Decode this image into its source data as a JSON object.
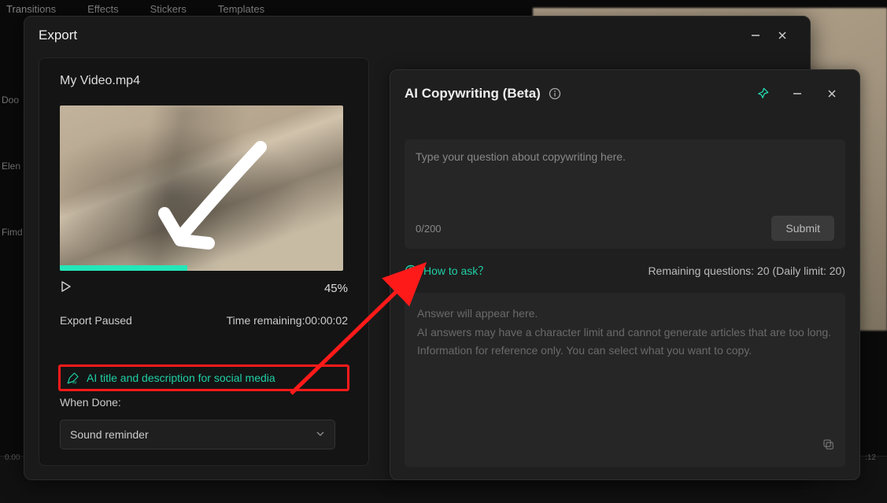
{
  "bg_tabs": [
    "Transitions",
    "Effects",
    "Stickers",
    "Templates"
  ],
  "bg_side": [
    "Doo",
    "Elen",
    "Fimd"
  ],
  "bg_time_left": "0.00",
  "bg_time_right": ":12",
  "export": {
    "title": "Export",
    "file_name": "My Video.mp4",
    "progress_percent": 45,
    "percent_label": "45%",
    "status": "Export Paused",
    "time_remaining_label": "Time remaining:",
    "time_remaining_value": "00:00:02",
    "ai_link": "AI title and description for social media",
    "when_done_label": "When Done:",
    "when_done_value": "Sound reminder"
  },
  "ai": {
    "title": "AI Copywriting (Beta)",
    "placeholder": "Type your question about copywriting here.",
    "char_count": "0/200",
    "submit": "Submit",
    "how_to_ask": "How to ask？",
    "remaining": "Remaining questions: 20 (Daily limit: 20)",
    "answer1": "Answer will appear here.",
    "answer2": "AI answers may have a character limit and cannot generate articles that are too long.",
    "answer3": "Information for reference only. You can select what you want to copy."
  }
}
